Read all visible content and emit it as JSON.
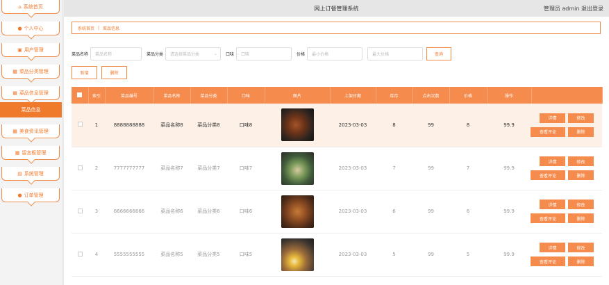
{
  "sidebar": {
    "items": [
      {
        "icon": "home-icon",
        "label": "系统首页"
      },
      {
        "icon": "person-icon",
        "label": "个人中心"
      },
      {
        "icon": "users-icon",
        "label": "用户管理"
      },
      {
        "icon": "grid-icon",
        "label": "菜品分类管理"
      },
      {
        "icon": "grid-icon",
        "label": "菜品信息管理"
      },
      {
        "icon": "",
        "label": "菜品信息"
      },
      {
        "icon": "grid-icon",
        "label": "美食资讯管理"
      },
      {
        "icon": "grid-icon",
        "label": "留言板管理"
      },
      {
        "icon": "briefcase-icon",
        "label": "系统管理"
      },
      {
        "icon": "person-icon",
        "label": "订单管理"
      }
    ]
  },
  "header": {
    "title": "网上订餐管理系统",
    "user": "管理员 admin  退出登录"
  },
  "breadcrumb": {
    "home": "系统首页",
    "sep": "|",
    "current": "菜品信息"
  },
  "search": {
    "name_label": "菜品名称",
    "name_placeholder": "菜品名称",
    "category_label": "菜品分类",
    "category_placeholder": "请选择菜品分类",
    "taste_label": "口味",
    "taste_placeholder": "口味",
    "price_label": "价格",
    "min_placeholder": "最小价格",
    "max_placeholder": "最大价格",
    "query_button": "查询"
  },
  "toolbar": {
    "add": "新增",
    "delete": "删除"
  },
  "table": {
    "headers": [
      "",
      "索引",
      "菜品编号",
      "菜品名称",
      "菜品分类",
      "口味",
      "图片",
      "上架日期",
      "库存",
      "点击次数",
      "价格",
      "操作"
    ],
    "header_checkbox": "",
    "rows": [
      {
        "index": "1",
        "code": "8888888888",
        "name": "菜品名称8",
        "category": "菜品分类8",
        "taste": "口味8",
        "date": "2023-03-03",
        "col8": "8",
        "stock": "99",
        "clicks": "8",
        "price": "99.9"
      },
      {
        "index": "2",
        "code": "7777777777",
        "name": "菜品名称7",
        "category": "菜品分类7",
        "taste": "口味7",
        "date": "2023-03-03",
        "col8": "7",
        "stock": "99",
        "clicks": "7",
        "price": "99.9"
      },
      {
        "index": "3",
        "code": "6666666666",
        "name": "菜品名称6",
        "category": "菜品分类6",
        "taste": "口味6",
        "date": "2023-03-03",
        "col8": "6",
        "stock": "99",
        "clicks": "6",
        "price": "99.9"
      },
      {
        "index": "4",
        "code": "5555555555",
        "name": "菜品名称5",
        "category": "菜品分类5",
        "taste": "口味5",
        "date": "2023-03-03",
        "col8": "5",
        "stock": "99",
        "clicks": "5",
        "price": "99.9"
      }
    ],
    "actions": {
      "detail": "详情",
      "edit": "修改",
      "reviews": "查看评论",
      "remove": "删除"
    }
  },
  "colors": {
    "accent": "#f07a2c",
    "header_fill": "#f58b4c"
  }
}
